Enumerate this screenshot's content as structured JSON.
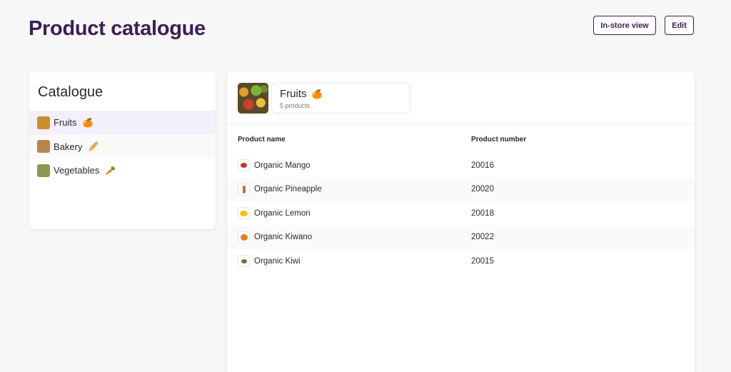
{
  "header": {
    "title": "Product catalogue",
    "instore_label": "In-store view",
    "edit_label": "Edit"
  },
  "sidebar": {
    "title": "Catalogue",
    "items": [
      {
        "label": "Fruits",
        "emoji": "🍊",
        "thumb": "#c9902a",
        "active": true
      },
      {
        "label": "Bakery",
        "emoji": "🥖",
        "thumb": "#b8864f",
        "active": false
      },
      {
        "label": "Vegetables",
        "emoji": "🥕",
        "thumb": "#8a9a55",
        "active": false
      }
    ]
  },
  "main": {
    "category": {
      "name": "Fruits",
      "emoji": "🍊",
      "count": "5 products"
    },
    "columns": {
      "name": "Product name",
      "number": "Product number"
    },
    "rows": [
      {
        "name": "Organic Mango",
        "number": "20016",
        "icon": "mango-icon",
        "color": "#c0392b"
      },
      {
        "name": "Organic Pineapple",
        "number": "20020",
        "icon": "pineapple-icon",
        "color": "#b07a2a"
      },
      {
        "name": "Organic Lemon",
        "number": "20018",
        "icon": "lemon-icon",
        "color": "#f1c40f"
      },
      {
        "name": "Organic Kiwano",
        "number": "20022",
        "icon": "kiwano-icon",
        "color": "#e67e22"
      },
      {
        "name": "Organic Kiwi",
        "number": "20015",
        "icon": "kiwi-icon",
        "color": "#7a6a2a"
      }
    ]
  }
}
